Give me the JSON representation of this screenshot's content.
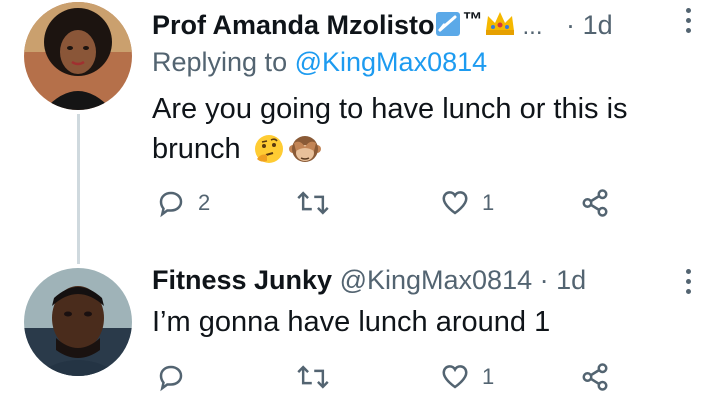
{
  "tweets": [
    {
      "author_name": "Prof Amanda Mzolisto",
      "badges": [
        "check-box-emoji",
        "tm-symbol",
        "crown-emoji"
      ],
      "tm": "™",
      "ellipsis": "...",
      "separator": "·",
      "time": "1d",
      "replying_prefix": "Replying to",
      "replying_handle": "@KingMax0814",
      "text_line1": "Are you going to have lunch or this is",
      "text_line2": "brunch",
      "emojis": [
        "thinking-face-emoji",
        "see-no-evil-monkey-emoji"
      ],
      "reply_count": "2",
      "retweet_count": "",
      "like_count": "1"
    },
    {
      "author_name": "Fitness Junky",
      "handle": "@KingMax0814",
      "separator": "·",
      "time": "1d",
      "text_line1": "I’m gonna have lunch around 1",
      "reply_count": "",
      "retweet_count": "",
      "like_count": "1"
    }
  ],
  "colors": {
    "text": "#0f1419",
    "secondary": "#536471",
    "link": "#1d9bf0",
    "thread_line": "#cfd9de"
  }
}
